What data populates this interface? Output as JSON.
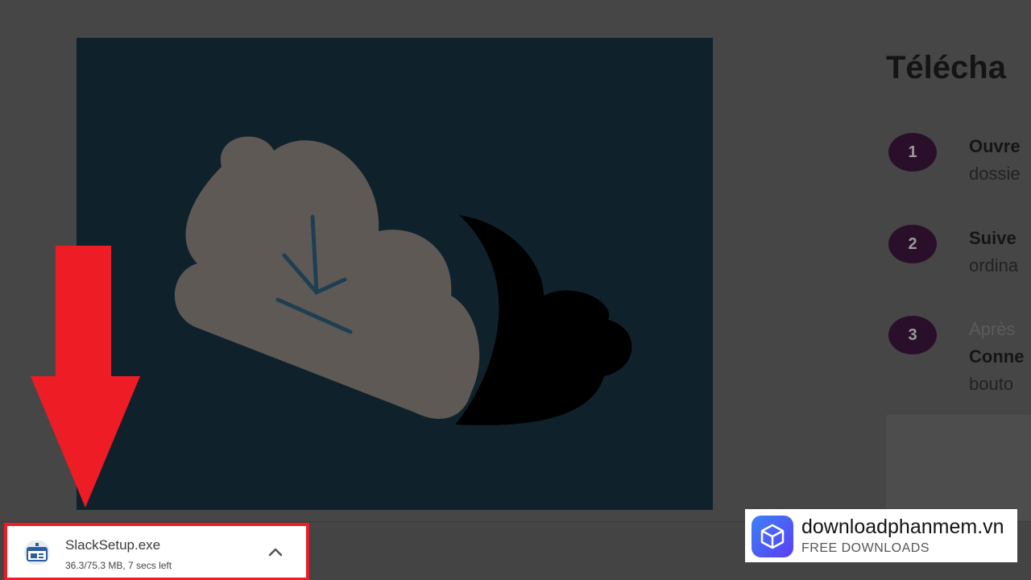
{
  "main": {
    "heading": "Télécha",
    "steps": [
      {
        "number": "1",
        "line1": "Ouvre",
        "line2": "dossie"
      },
      {
        "number": "2",
        "line1": "Suive",
        "line2": "ordina"
      },
      {
        "number": "3",
        "line1": "Après",
        "line2": "Conne",
        "line3": "bouto"
      }
    ]
  },
  "download": {
    "file_name": "SlackSetup.exe",
    "progress": "36.3/75.3 MB, 7 secs left",
    "icon": "installer-file-icon",
    "chevron_icon": "chevron-up-icon",
    "highlight_color": "#ee1c25"
  },
  "annotation": {
    "arrow_icon": "red-down-arrow",
    "arrow_color": "#ee1c25"
  },
  "watermark": {
    "name": "downloadphanmem.vn",
    "tagline": "FREE DOWNLOADS",
    "logo_icon": "package-box-icon"
  },
  "hero": {
    "illustration": "cloud-download-icon",
    "background_color": "#0f222c"
  }
}
